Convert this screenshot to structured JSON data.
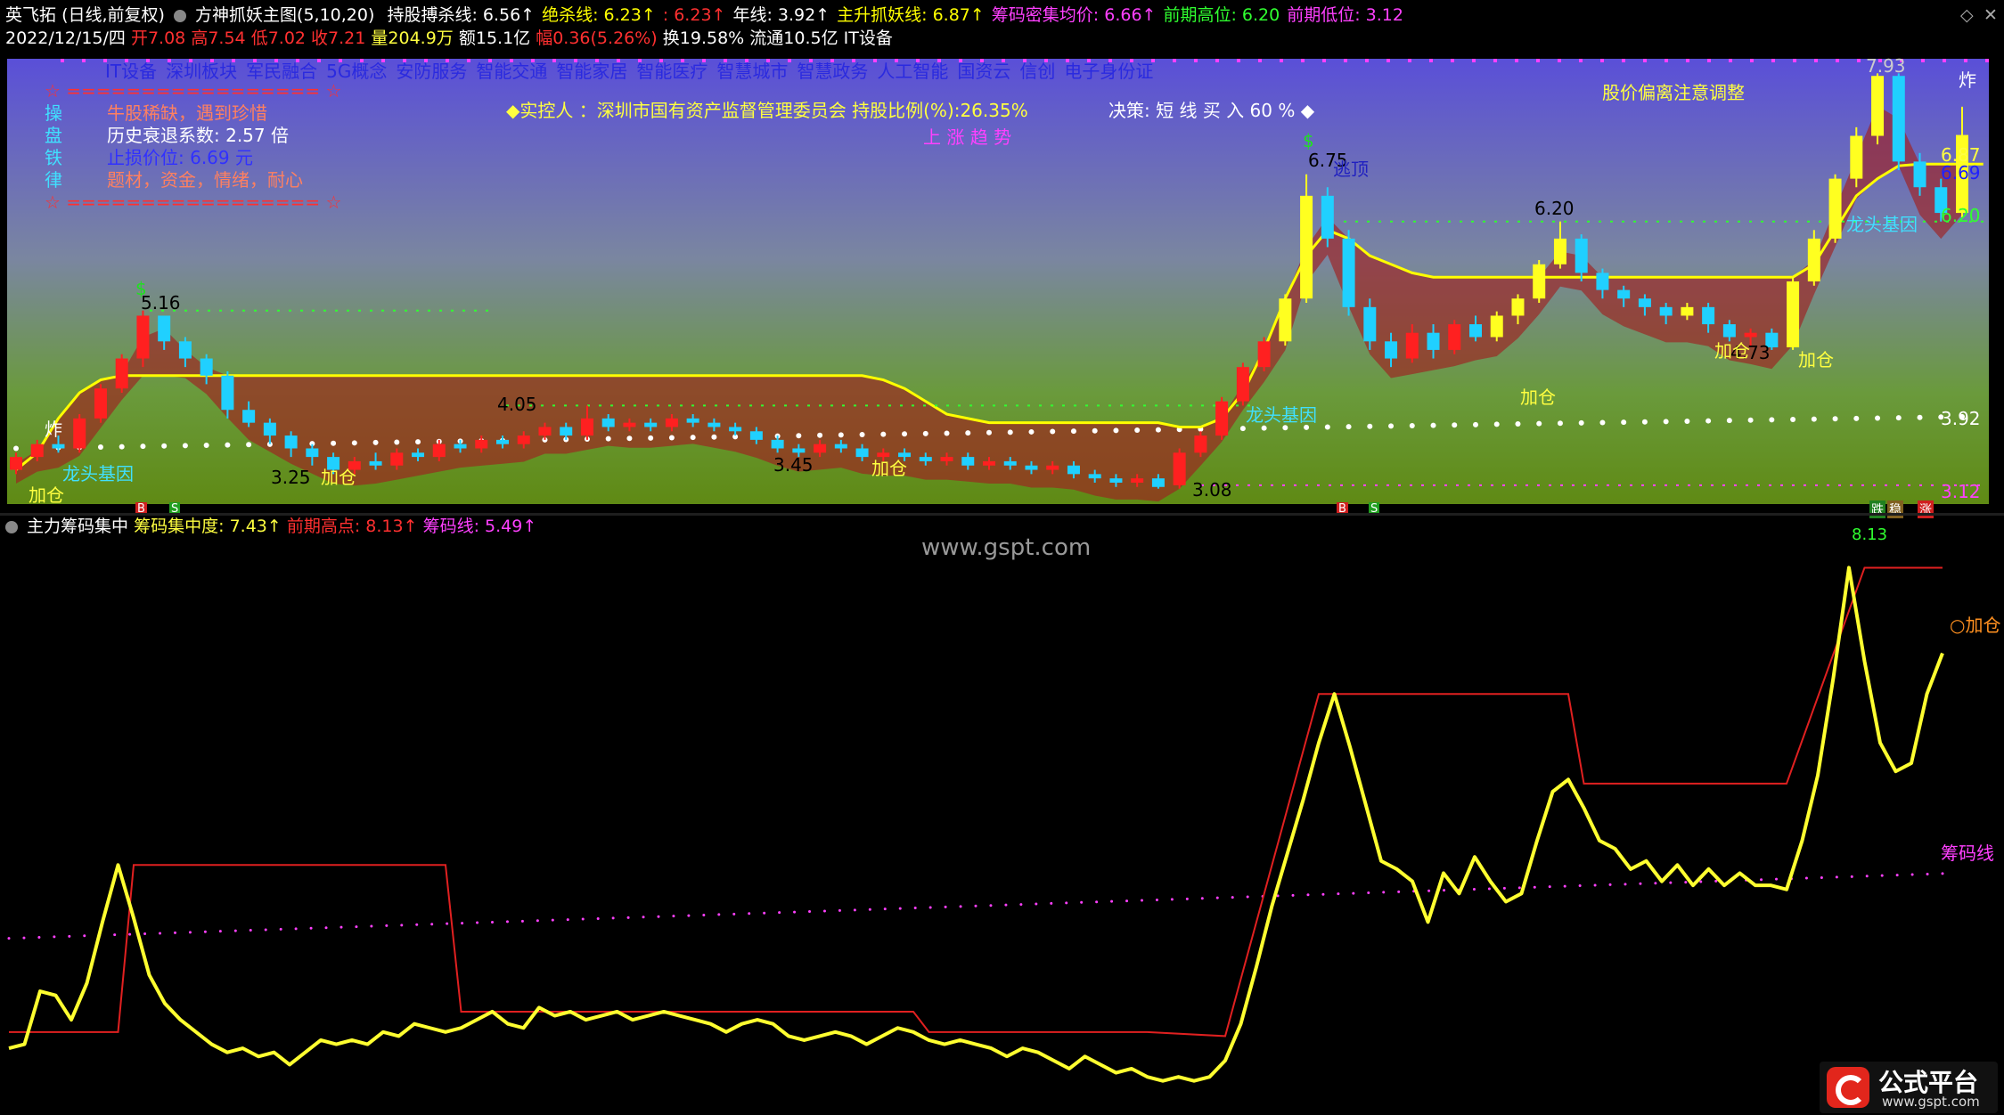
{
  "header": {
    "stock_name": "英飞拓",
    "period": "(日线,前复权)",
    "indicator_name": "方神抓妖主图(5,10,20)",
    "lines": [
      {
        "label": "持股搏杀线:",
        "value": "6.56",
        "arrow": "↑",
        "color": "#ffffff"
      },
      {
        "label": "绝杀线:",
        "value": "6.23",
        "arrow": "↑",
        "color": "#ffff00"
      },
      {
        "label": ":",
        "value": "6.23",
        "arrow": "↑",
        "color": "#ff3030"
      },
      {
        "label": "年线:",
        "value": "3.92",
        "arrow": "↑",
        "color": "#ffffff"
      },
      {
        "label": "主升抓妖线:",
        "value": "6.87",
        "arrow": "↑",
        "color": "#ffff00"
      },
      {
        "label": "筹码密集均价:",
        "value": "6.66",
        "arrow": "↑",
        "color": "#ff40ff"
      },
      {
        "label": "前期高位:",
        "value": "6.20",
        "arrow": "",
        "color": "#30ff30"
      },
      {
        "label": "前期低位:",
        "value": "3.12",
        "arrow": "",
        "color": "#ff40ff"
      }
    ],
    "date": "2022/12/15/四",
    "open": "开7.08",
    "high": "高7.54",
    "low": "低7.02",
    "close": "收7.21",
    "volume": "量204.9万",
    "amount": "额15.1亿",
    "range": "幅0.36(5.26%)",
    "turnover": "换19.58%",
    "float": "流通10.5亿",
    "sector": "IT设备"
  },
  "concepts": [
    "IT设备",
    "深圳板块",
    "军民融合",
    "5G概念",
    "安防服务",
    "智能交通",
    "智能家居",
    "智能医疗",
    "智慧城市",
    "智慧政务",
    "人工智能",
    "国资云",
    "信创",
    "电子身份证"
  ],
  "info_panel": {
    "border": "☆ ================= ☆",
    "rows": [
      {
        "key": "操",
        "value": "牛股稀缺，遇到珍惜",
        "color": "#ff8060"
      },
      {
        "key": "盘",
        "value": "历史衰退系数:     2.57 倍",
        "color": "#ffffff"
      },
      {
        "key": "铁",
        "value": "止损价位:     6.69 元",
        "color": "#3030ff"
      },
      {
        "key": "律",
        "value": "题材，资金，情绪，耐心",
        "color": "#ff8060"
      }
    ]
  },
  "controller": "◆实控人 ：深圳市国有资产监督管理委员会 持股比例(%):26.35%",
  "trend_text": "上 涨 趋 势",
  "decision": "决策:  短 线 买 入 60 % ◆",
  "deviation": "股价偏离注意调整",
  "price_labels": [
    "5.16",
    "4.05",
    "3.45",
    "3.25",
    "6.75",
    "6.20",
    "4.73",
    "7.93",
    "6.87",
    "6.69",
    "6.20",
    "3.92",
    "3.08",
    "3.12"
  ],
  "annotations": {
    "add": "加仓",
    "dragon": "龙头基因",
    "escape": "逃顶",
    "boom": "炸",
    "dollar": "$"
  },
  "markers": [
    "B",
    "S",
    "B",
    "S",
    "跌",
    "稳",
    "涨"
  ],
  "sub_header": {
    "name": "主力筹码集中",
    "concentration_label": "筹码集中度:",
    "concentration": "7.43",
    "peak_label": "前期高点:",
    "peak": "8.13",
    "line_label": "筹码线:",
    "line": "5.49",
    "arrow": "↑"
  },
  "sub_labels": {
    "add": "加仓",
    "chip_line": "筹码线",
    "top_value": "8.13"
  },
  "watermark": "www.gspt.com",
  "logo": {
    "title": "公式平台",
    "url": "www.gspt.com"
  },
  "colors": {
    "up": "#ff2020",
    "down": "#20d0ff",
    "ma_yellow": "#ffff00",
    "green": "#20e020",
    "magenta": "#ff40ff",
    "band_fill": "#a02020"
  },
  "chip_data": {
    "concentration": [
      1.2,
      1.3,
      2.6,
      2.5,
      1.9,
      2.8,
      4.3,
      5.7,
      4.4,
      3.0,
      2.3,
      1.9,
      1.6,
      1.3,
      1.1,
      1.2,
      1.0,
      1.1,
      0.8,
      1.1,
      1.4,
      1.3,
      1.4,
      1.3,
      1.6,
      1.5,
      1.8,
      1.7,
      1.6,
      1.7,
      1.9,
      2.1,
      1.8,
      1.7,
      2.2,
      2.0,
      2.1,
      1.9,
      2.0,
      2.1,
      1.9,
      2.0,
      2.1,
      2.0,
      1.9,
      1.8,
      1.6,
      1.8,
      1.9,
      1.8,
      1.5,
      1.4,
      1.5,
      1.6,
      1.5,
      1.3,
      1.5,
      1.7,
      1.6,
      1.4,
      1.3,
      1.4,
      1.3,
      1.2,
      1.0,
      1.2,
      1.1,
      0.9,
      0.7,
      1.0,
      0.8,
      0.6,
      0.7,
      0.5,
      0.4,
      0.5,
      0.4,
      0.5,
      0.9,
      1.8,
      3.2,
      4.7,
      6.0,
      7.3,
      8.7,
      9.9,
      8.6,
      7.2,
      5.8,
      5.6,
      5.3,
      4.3,
      5.5,
      5.0,
      5.9,
      5.3,
      4.8,
      5.0,
      6.3,
      7.5,
      7.8,
      7.1,
      6.3,
      6.1,
      5.6,
      5.8,
      5.3,
      5.7,
      5.2,
      5.6,
      5.2,
      5.5,
      5.2,
      5.2,
      5.1,
      6.3,
      7.9,
      10.3,
      13.0,
      10.7,
      8.7,
      8.0,
      8.2,
      9.9,
      10.9
    ],
    "peak_steps": [
      [
        0,
        1.6
      ],
      [
        7,
        1.6
      ],
      [
        8,
        5.7
      ],
      [
        28,
        5.7
      ],
      [
        29,
        2.1
      ],
      [
        58,
        2.1
      ],
      [
        59,
        1.6
      ],
      [
        73,
        1.6
      ],
      [
        78,
        1.5
      ],
      [
        84,
        9.9
      ],
      [
        100,
        9.9
      ],
      [
        101,
        7.7
      ],
      [
        114,
        7.7
      ],
      [
        119,
        13.0
      ],
      [
        124,
        13.0
      ]
    ],
    "chip_line": [
      3.9,
      3.95,
      4.0,
      4.05,
      4.1,
      4.15,
      4.2,
      4.25,
      4.3,
      4.35,
      4.4,
      4.45,
      4.5,
      4.55,
      4.6,
      4.65,
      4.7,
      4.75,
      4.8,
      4.85,
      4.9,
      4.95,
      5.0,
      5.05,
      5.1,
      5.15,
      5.2,
      5.25,
      5.3,
      5.35,
      5.4,
      5.45,
      5.49
    ]
  },
  "price_data": {
    "candles": [
      [
        3.3,
        3.45,
        3.25,
        3.5
      ],
      [
        3.45,
        3.6,
        3.4,
        3.65
      ],
      [
        3.6,
        3.55,
        3.5,
        3.7
      ],
      [
        3.55,
        3.9,
        3.5,
        3.95
      ],
      [
        3.9,
        4.25,
        3.85,
        4.3
      ],
      [
        4.25,
        4.6,
        4.2,
        4.65
      ],
      [
        4.6,
        5.1,
        4.5,
        5.16
      ],
      [
        5.1,
        4.8,
        4.7,
        5.1
      ],
      [
        4.8,
        4.6,
        4.5,
        4.85
      ],
      [
        4.6,
        4.4,
        4.3,
        4.65
      ],
      [
        4.4,
        4.0,
        3.9,
        4.45
      ],
      [
        4.0,
        3.85,
        3.8,
        4.1
      ],
      [
        3.85,
        3.7,
        3.6,
        3.9
      ],
      [
        3.7,
        3.55,
        3.45,
        3.75
      ],
      [
        3.55,
        3.45,
        3.35,
        3.6
      ],
      [
        3.45,
        3.3,
        3.25,
        3.5
      ],
      [
        3.3,
        3.4,
        3.25,
        3.45
      ],
      [
        3.4,
        3.35,
        3.3,
        3.5
      ],
      [
        3.35,
        3.5,
        3.3,
        3.55
      ],
      [
        3.5,
        3.45,
        3.4,
        3.55
      ],
      [
        3.45,
        3.6,
        3.4,
        3.65
      ],
      [
        3.6,
        3.55,
        3.5,
        3.65
      ],
      [
        3.55,
        3.65,
        3.5,
        3.7
      ],
      [
        3.65,
        3.6,
        3.55,
        3.7
      ],
      [
        3.6,
        3.7,
        3.55,
        3.75
      ],
      [
        3.7,
        3.8,
        3.65,
        3.85
      ],
      [
        3.8,
        3.7,
        3.65,
        3.85
      ],
      [
        3.7,
        3.9,
        3.65,
        4.05
      ],
      [
        3.9,
        3.8,
        3.75,
        3.95
      ],
      [
        3.8,
        3.85,
        3.75,
        3.9
      ],
      [
        3.85,
        3.8,
        3.75,
        3.9
      ],
      [
        3.8,
        3.9,
        3.75,
        3.95
      ],
      [
        3.9,
        3.85,
        3.8,
        3.95
      ],
      [
        3.85,
        3.8,
        3.75,
        3.9
      ],
      [
        3.8,
        3.75,
        3.7,
        3.85
      ],
      [
        3.75,
        3.65,
        3.6,
        3.8
      ],
      [
        3.65,
        3.55,
        3.5,
        3.7
      ],
      [
        3.55,
        3.5,
        3.45,
        3.6
      ],
      [
        3.5,
        3.6,
        3.45,
        3.65
      ],
      [
        3.6,
        3.55,
        3.5,
        3.65
      ],
      [
        3.55,
        3.45,
        3.4,
        3.6
      ],
      [
        3.45,
        3.5,
        3.4,
        3.55
      ],
      [
        3.5,
        3.45,
        3.4,
        3.55
      ],
      [
        3.45,
        3.4,
        3.35,
        3.5
      ],
      [
        3.4,
        3.45,
        3.35,
        3.5
      ],
      [
        3.45,
        3.35,
        3.3,
        3.5
      ],
      [
        3.35,
        3.4,
        3.3,
        3.45
      ],
      [
        3.4,
        3.35,
        3.3,
        3.45
      ],
      [
        3.35,
        3.3,
        3.25,
        3.4
      ],
      [
        3.3,
        3.35,
        3.25,
        3.4
      ],
      [
        3.35,
        3.25,
        3.2,
        3.4
      ],
      [
        3.25,
        3.2,
        3.15,
        3.3
      ],
      [
        3.2,
        3.15,
        3.1,
        3.25
      ],
      [
        3.15,
        3.2,
        3.1,
        3.25
      ],
      [
        3.2,
        3.1,
        3.08,
        3.25
      ],
      [
        3.12,
        3.5,
        3.08,
        3.55
      ],
      [
        3.5,
        3.7,
        3.45,
        3.75
      ],
      [
        3.7,
        4.1,
        3.65,
        4.15
      ],
      [
        4.1,
        4.5,
        4.05,
        4.55
      ],
      [
        4.5,
        4.8,
        4.45,
        4.85
      ],
      [
        4.8,
        5.3,
        4.75,
        5.35
      ],
      [
        5.3,
        6.5,
        5.25,
        6.75
      ],
      [
        6.5,
        6.0,
        5.9,
        6.6
      ],
      [
        6.0,
        5.2,
        5.1,
        6.1
      ],
      [
        5.2,
        4.8,
        4.7,
        5.3
      ],
      [
        4.8,
        4.6,
        4.5,
        4.9
      ],
      [
        4.6,
        4.9,
        4.55,
        5.0
      ],
      [
        4.9,
        4.7,
        4.6,
        5.0
      ],
      [
        4.7,
        5.0,
        4.65,
        5.05
      ],
      [
        5.0,
        4.85,
        4.8,
        5.1
      ],
      [
        4.85,
        5.1,
        4.8,
        5.15
      ],
      [
        5.1,
        5.3,
        5.0,
        5.35
      ],
      [
        5.3,
        5.7,
        5.25,
        5.75
      ],
      [
        5.7,
        6.0,
        5.65,
        6.2
      ],
      [
        6.0,
        5.6,
        5.5,
        6.05
      ],
      [
        5.6,
        5.4,
        5.3,
        5.65
      ],
      [
        5.4,
        5.3,
        5.2,
        5.45
      ],
      [
        5.3,
        5.2,
        5.1,
        5.35
      ],
      [
        5.2,
        5.1,
        5.0,
        5.25
      ],
      [
        5.1,
        5.2,
        5.05,
        5.25
      ],
      [
        5.2,
        5.0,
        4.9,
        5.25
      ],
      [
        5.0,
        4.85,
        4.8,
        5.05
      ],
      [
        4.85,
        4.9,
        4.75,
        4.95
      ],
      [
        4.9,
        4.73,
        4.7,
        4.95
      ],
      [
        4.73,
        5.5,
        4.7,
        5.55
      ],
      [
        5.5,
        6.0,
        5.45,
        6.1
      ],
      [
        6.0,
        6.7,
        5.95,
        6.75
      ],
      [
        6.7,
        7.2,
        6.6,
        7.3
      ],
      [
        7.2,
        7.9,
        7.1,
        7.93
      ],
      [
        7.9,
        6.9,
        6.8,
        7.93
      ],
      [
        6.9,
        6.6,
        6.5,
        7.0
      ],
      [
        6.6,
        6.3,
        6.2,
        6.7
      ],
      [
        6.3,
        7.21,
        6.25,
        7.54
      ]
    ],
    "ma_yellow": [
      3.3,
      3.5,
      3.9,
      4.2,
      4.35,
      4.4,
      4.4,
      4.4,
      4.4,
      4.4,
      4.4,
      4.4,
      4.4,
      4.4,
      4.4,
      4.4,
      4.4,
      4.4,
      4.4,
      4.4,
      4.4,
      4.4,
      4.4,
      4.4,
      4.4,
      4.4,
      4.4,
      4.4,
      4.4,
      4.4,
      4.4,
      4.4,
      4.4,
      4.4,
      4.4,
      4.4,
      4.4,
      4.4,
      4.4,
      4.4,
      4.4,
      4.35,
      4.25,
      4.1,
      3.95,
      3.9,
      3.85,
      3.85,
      3.85,
      3.85,
      3.85,
      3.85,
      3.85,
      3.85,
      3.85,
      3.8,
      3.8,
      3.9,
      4.2,
      4.7,
      5.3,
      5.8,
      6.1,
      6.0,
      5.8,
      5.7,
      5.6,
      5.55,
      5.55,
      5.55,
      5.55,
      5.55,
      5.55,
      5.55,
      5.55,
      5.55,
      5.55,
      5.55,
      5.55,
      5.55,
      5.55,
      5.55,
      5.55,
      5.55,
      5.55,
      5.7,
      6.1,
      6.5,
      6.7,
      6.85,
      6.87,
      6.87,
      6.87,
      6.87
    ]
  }
}
